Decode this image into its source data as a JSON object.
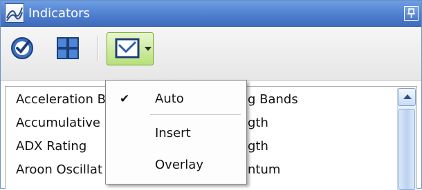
{
  "panel": {
    "title": "Indicators",
    "pin_glyph": "↑",
    "title_icon": "chart-lines-icon"
  },
  "toolbar": {
    "select_all_icon": "check-circle-icon",
    "layout_icon": "grid-icon",
    "mode_icon": "chart-check-icon"
  },
  "list": {
    "left_column": [
      "Acceleration B",
      "Accumulative",
      "ADX Rating",
      "Aroon Oscillat"
    ],
    "right_column": [
      "g Bands",
      "gth",
      "gth",
      "ntum"
    ]
  },
  "mode_menu": {
    "items": [
      {
        "label": "Auto",
        "checked": true
      },
      {
        "label": "Insert",
        "checked": false
      },
      {
        "label": "Overlay",
        "checked": false
      }
    ],
    "check_glyph": "✔"
  },
  "colors": {
    "title_blue": "#4f7fcf",
    "active_green": "#b8e07a"
  }
}
